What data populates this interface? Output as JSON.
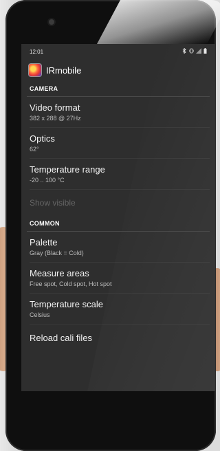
{
  "status_bar": {
    "time": "12:01",
    "icons": [
      "bluetooth-icon",
      "vibrate-icon",
      "signal-icon",
      "battery-icon"
    ]
  },
  "app_bar": {
    "title": "IRmobile",
    "logo_icon": "irmobile-logo-icon"
  },
  "sections": [
    {
      "header": "CAMERA",
      "items": [
        {
          "title": "Video format",
          "summary": "382 x 288 @ 27Hz"
        },
        {
          "title": "Optics",
          "summary": "62°"
        },
        {
          "title": "Temperature range",
          "summary": "-20 .. 100 °C"
        },
        {
          "title": "Show visible",
          "summary": "",
          "disabled": true
        }
      ]
    },
    {
      "header": "COMMON",
      "items": [
        {
          "title": "Palette",
          "summary": "Gray (Black = Cold)"
        },
        {
          "title": "Measure areas",
          "summary": "Free spot, Cold spot, Hot spot"
        },
        {
          "title": "Temperature scale",
          "summary": "Celsius"
        },
        {
          "title": "Reload cali files",
          "summary": ""
        }
      ]
    }
  ],
  "colors": {
    "screen_background": "#2e2e2e",
    "primary_text": "#f2f2f2",
    "secondary_text": "#bdbdbd",
    "disabled_text": "#666666"
  }
}
